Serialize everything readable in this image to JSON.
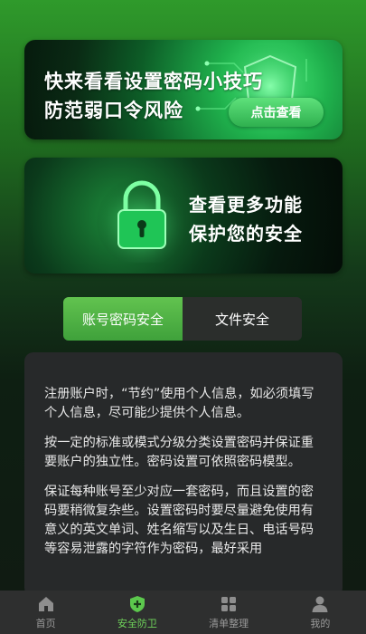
{
  "banner1": {
    "line1": "快来看看设置密码小技巧",
    "line2": "防范弱口令风险",
    "button": "点击查看"
  },
  "banner2": {
    "line1": "查看更多功能",
    "line2": "保护您的安全"
  },
  "tabs": [
    {
      "label": "账号密码安全",
      "active": true
    },
    {
      "label": "文件安全",
      "active": false
    }
  ],
  "content": {
    "paragraphs": [
      "注册账户时，“节约”使用个人信息，如必须填写个人信息，尽可能少提供个人信息。",
      "按一定的标准或模式分级分类设置密码并保证重要账户的独立性。密码设置可依照密码模型。",
      "保证每种账号至少对应一套密码，而且设置的密码要稍微复杂些。设置密码时要尽量避免使用有意义的英文单词、姓名缩写以及生日、电话号码等容易泄露的字符作为密码，最好采用"
    ]
  },
  "tabbar": {
    "items": [
      {
        "label": "首页",
        "icon": "home-icon",
        "active": false
      },
      {
        "label": "安全防卫",
        "icon": "shield-plus-icon",
        "active": true
      },
      {
        "label": "清单整理",
        "icon": "grid-icon",
        "active": false
      },
      {
        "label": "我的",
        "icon": "user-icon",
        "active": false
      }
    ]
  },
  "colors": {
    "accent": "#5cc84d",
    "tabbar_bg": "#2e2f2f",
    "card_bg": "#27292a"
  }
}
